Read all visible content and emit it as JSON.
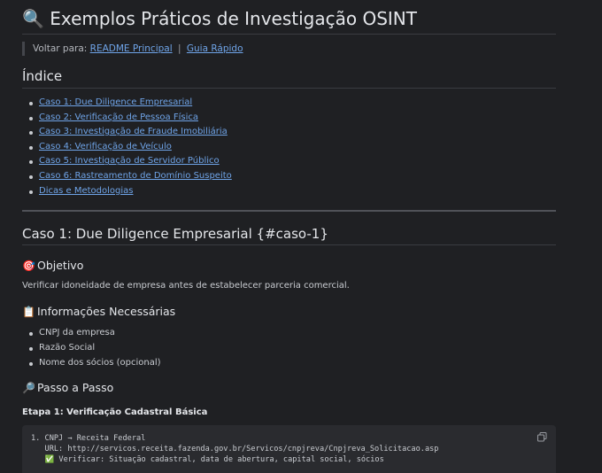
{
  "header": {
    "icon": "magnifier-icon",
    "title": "Exemplos Práticos de Investigação OSINT"
  },
  "backlinks": {
    "prefix": "Voltar para:",
    "separator": "|",
    "links": [
      "README Principal",
      "Guia Rápido"
    ]
  },
  "toc": {
    "heading": "Índice",
    "items": [
      "Caso 1: Due Diligence Empresarial",
      "Caso 2: Verificação de Pessoa Física",
      "Caso 3: Investigação de Fraude Imobiliária",
      "Caso 4: Verificação de Veículo",
      "Caso 5: Investigação de Servidor Público",
      "Caso 6: Rastreamento de Domínio Suspeito",
      "Dicas e Metodologias"
    ]
  },
  "caso1": {
    "heading": "Caso 1: Due Diligence Empresarial {#caso-1}",
    "objetivo": {
      "emoji": "🎯",
      "heading": "Objetivo",
      "text": "Verificar idoneidade de empresa antes de estabelecer parceria comercial."
    },
    "info": {
      "emoji": "📋",
      "heading": "Informações Necessárias",
      "items": [
        "CNPJ da empresa",
        "Razão Social",
        "Nome dos sócios (opcional)"
      ]
    },
    "passo": {
      "emoji": "🔎",
      "heading": "Passo a Passo"
    },
    "etapa1": {
      "heading": "Etapa 1: Verificação Cadastral Básica",
      "code_lines": [
        "1. CNPJ → Receita Federal",
        "   URL: http://servicos.receita.fazenda.gov.br/Servicos/cnpjreva/Cnpjreva_Solicitacao.asp",
        "   ✅ Verificar: Situação cadastral, data de abertura, capital social, sócios"
      ],
      "copy_icon": "copy-icon"
    }
  }
}
